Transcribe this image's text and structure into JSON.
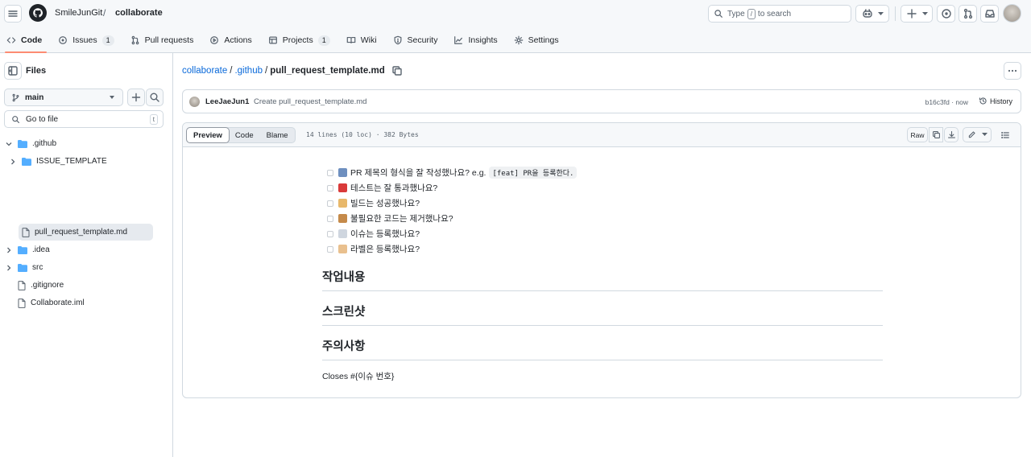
{
  "header": {
    "owner": "SmileJunGit",
    "separator": "/",
    "repo": "collaborate",
    "search_prefix": "Type",
    "search_key": "/",
    "search_suffix": "to search"
  },
  "tabs": [
    {
      "label": "Code",
      "count": null,
      "selected": true
    },
    {
      "label": "Issues",
      "count": "1"
    },
    {
      "label": "Pull requests",
      "count": null
    },
    {
      "label": "Actions",
      "count": null
    },
    {
      "label": "Projects",
      "count": "1"
    },
    {
      "label": "Wiki",
      "count": null
    },
    {
      "label": "Security",
      "count": null
    },
    {
      "label": "Insights",
      "count": null
    },
    {
      "label": "Settings",
      "count": null
    }
  ],
  "sidebar": {
    "title": "Files",
    "branch": "main",
    "goto_placeholder": "Go to file",
    "goto_key": "t",
    "tree": [
      {
        "name": ".github",
        "type": "folder",
        "expanded": true
      },
      {
        "name": "ISSUE_TEMPLATE",
        "type": "folder",
        "expanded": false
      },
      {
        "name": "pull_request_template.md",
        "type": "file",
        "selected": true
      },
      {
        "name": ".idea",
        "type": "folder",
        "expanded": false
      },
      {
        "name": "src",
        "type": "folder",
        "expanded": false
      },
      {
        "name": ".gitignore",
        "type": "file"
      },
      {
        "name": "Collaborate.iml",
        "type": "file"
      }
    ]
  },
  "path": {
    "repo": "collaborate",
    "folder": ".github",
    "file": "pull_request_template.md"
  },
  "commit": {
    "author": "LeeJaeJun1",
    "message": "Create pull_request_template.md",
    "sha": "b16c3fd · now",
    "history": "History"
  },
  "file": {
    "view_tabs": [
      "Preview",
      "Code",
      "Blame"
    ],
    "info": "14 lines (10 loc) · 382 Bytes",
    "raw": "Raw"
  },
  "markdown": {
    "tasks": [
      {
        "text": "PR 제목의 형식을 잘 작성했나요? e.g.",
        "code": "[feat] PR을 등록한다.",
        "emoji": "abc-icon",
        "color": "#6e8fbf"
      },
      {
        "text": "테스트는 잘 통과했나요?",
        "code": "",
        "emoji": "hundred-icon",
        "color": "#d93a3a"
      },
      {
        "text": "빌드는 성공했나요?",
        "code": "",
        "emoji": "building-icon",
        "color": "#e8b86b"
      },
      {
        "text": "불필요한 코드는 제거했나요?",
        "code": "",
        "emoji": "broom-icon",
        "color": "#c58a4a"
      },
      {
        "text": "이슈는 등록했나요?",
        "code": "",
        "emoji": "speech-icon",
        "color": "#cfd6df"
      },
      {
        "text": "라벨은 등록했나요?",
        "code": "",
        "emoji": "label-icon",
        "color": "#e9c08e"
      }
    ],
    "headings": [
      "작업내용",
      "스크린샷",
      "주의사항"
    ],
    "closing": "Closes #{이슈 번호}"
  },
  "colors": {
    "accent": "#0969da",
    "tab_underline": "#fd8c73",
    "border": "#d1d9e0"
  }
}
